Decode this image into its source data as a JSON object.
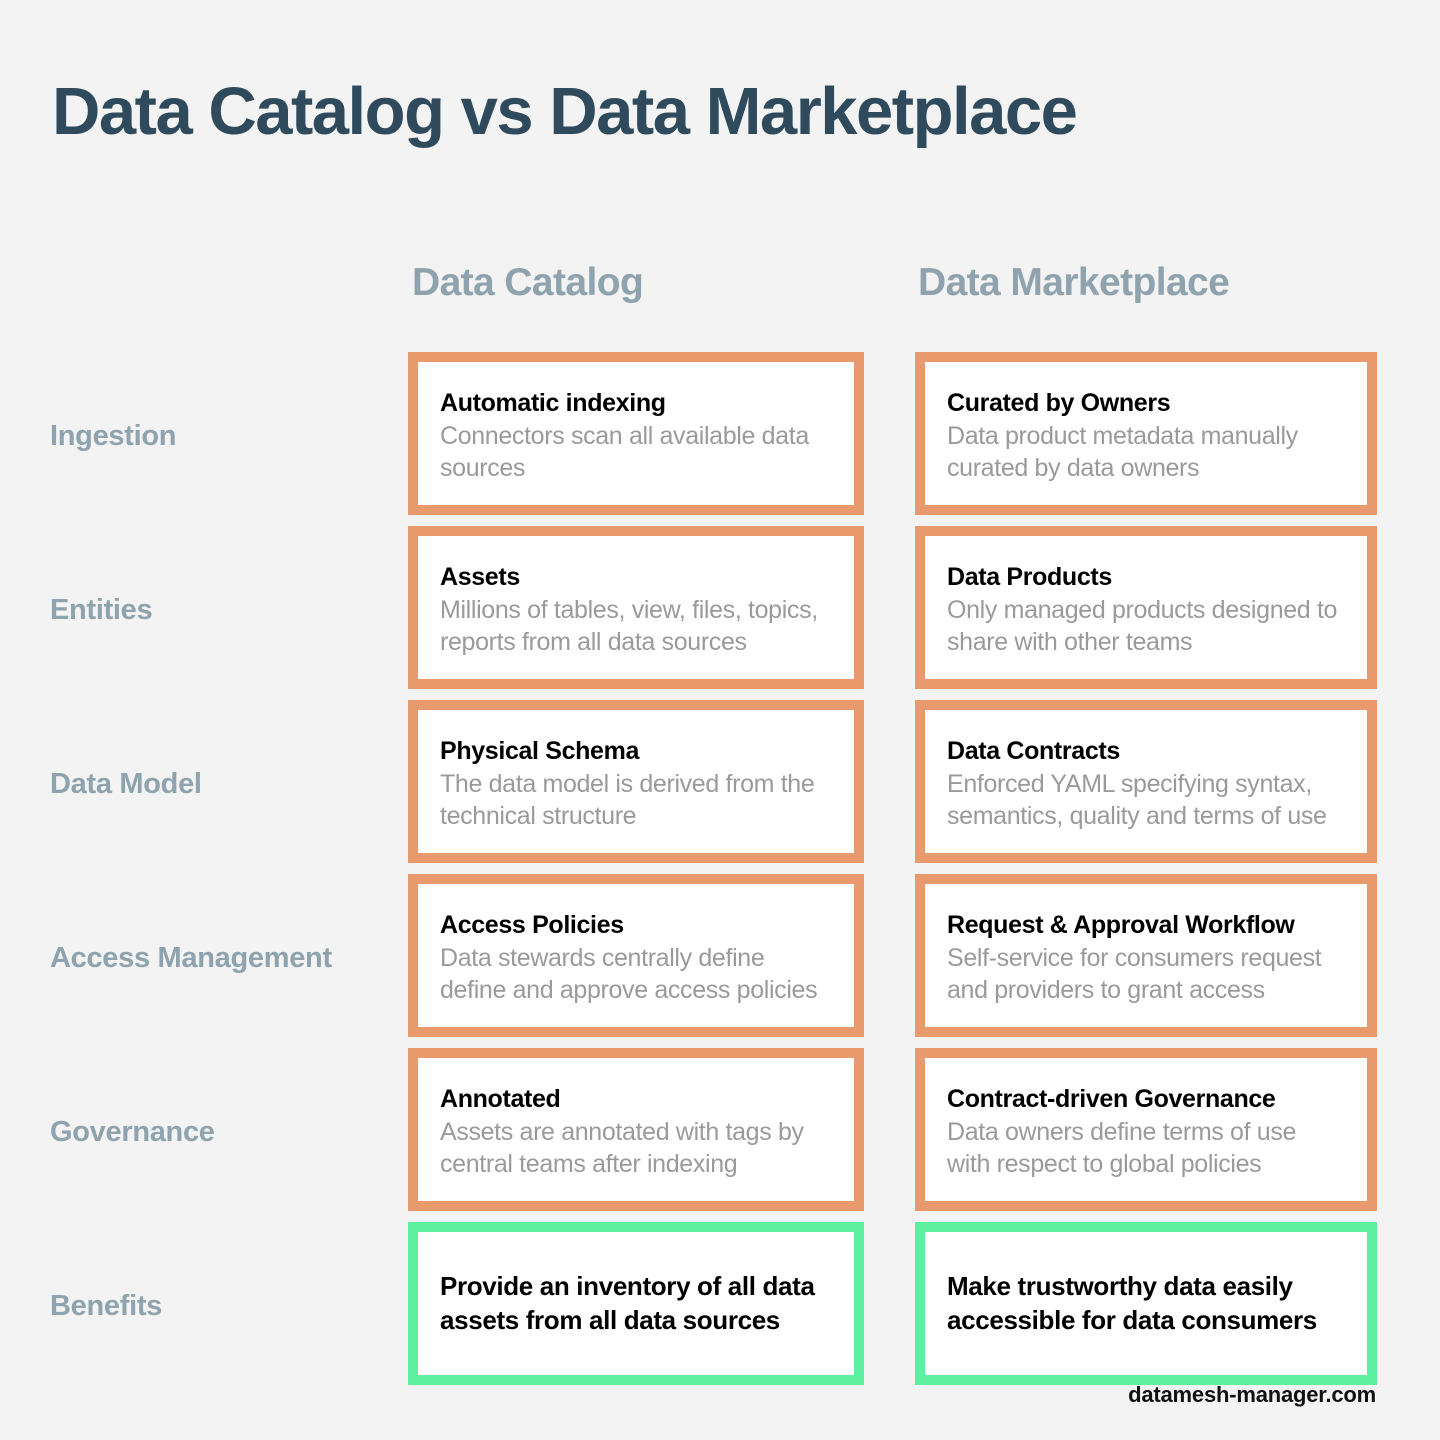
{
  "title": "Data Catalog vs Data Marketplace",
  "columns": [
    {
      "label": "Data Catalog"
    },
    {
      "label": "Data Marketplace"
    }
  ],
  "colors": {
    "background": "#F2F3F2",
    "title": "#2E4A5C",
    "column_header": "#8FA3AE",
    "row_label": "#8FA3AE",
    "card_border": "#E89A6C",
    "benefit_border": "#5CF0A0",
    "card_title": "#000000",
    "card_desc": "#9A9A9A"
  },
  "rows": [
    {
      "label": "Ingestion",
      "catalog": {
        "title": "Automatic indexing",
        "desc": "Connectors scan all available data sources"
      },
      "marketplace": {
        "title": "Curated by Owners",
        "desc": "Data product metadata manually curated by data owners"
      }
    },
    {
      "label": "Entities",
      "catalog": {
        "title": "Assets",
        "desc": "Millions of tables, view, files, topics, reports from all data sources"
      },
      "marketplace": {
        "title": "Data Products",
        "desc": "Only managed products designed to share with other teams"
      }
    },
    {
      "label": "Data Model",
      "catalog": {
        "title": "Physical Schema",
        "desc": "The data model is derived from the technical structure"
      },
      "marketplace": {
        "title": "Data Contracts",
        "desc": "Enforced YAML specifying syntax, semantics, quality and terms of use"
      }
    },
    {
      "label": "Access Management",
      "catalog": {
        "title": "Access Policies",
        "desc": "Data stewards centrally define define and approve access policies"
      },
      "marketplace": {
        "title": "Request & Approval Workflow",
        "desc": "Self-service for consumers request and providers to grant access"
      }
    },
    {
      "label": "Governance",
      "catalog": {
        "title": "Annotated",
        "desc": "Assets are annotated with tags by central teams after indexing"
      },
      "marketplace": {
        "title": "Contract-driven Governance",
        "desc": "Data owners define terms of use with respect to global policies"
      }
    },
    {
      "label": "Benefits",
      "catalog": {
        "title": "Provide an inventory of all data assets from all data sources",
        "desc": ""
      },
      "marketplace": {
        "title": "Make trustworthy data easily accessible for data consumers",
        "desc": ""
      }
    }
  ],
  "footer": "datamesh-manager.com"
}
